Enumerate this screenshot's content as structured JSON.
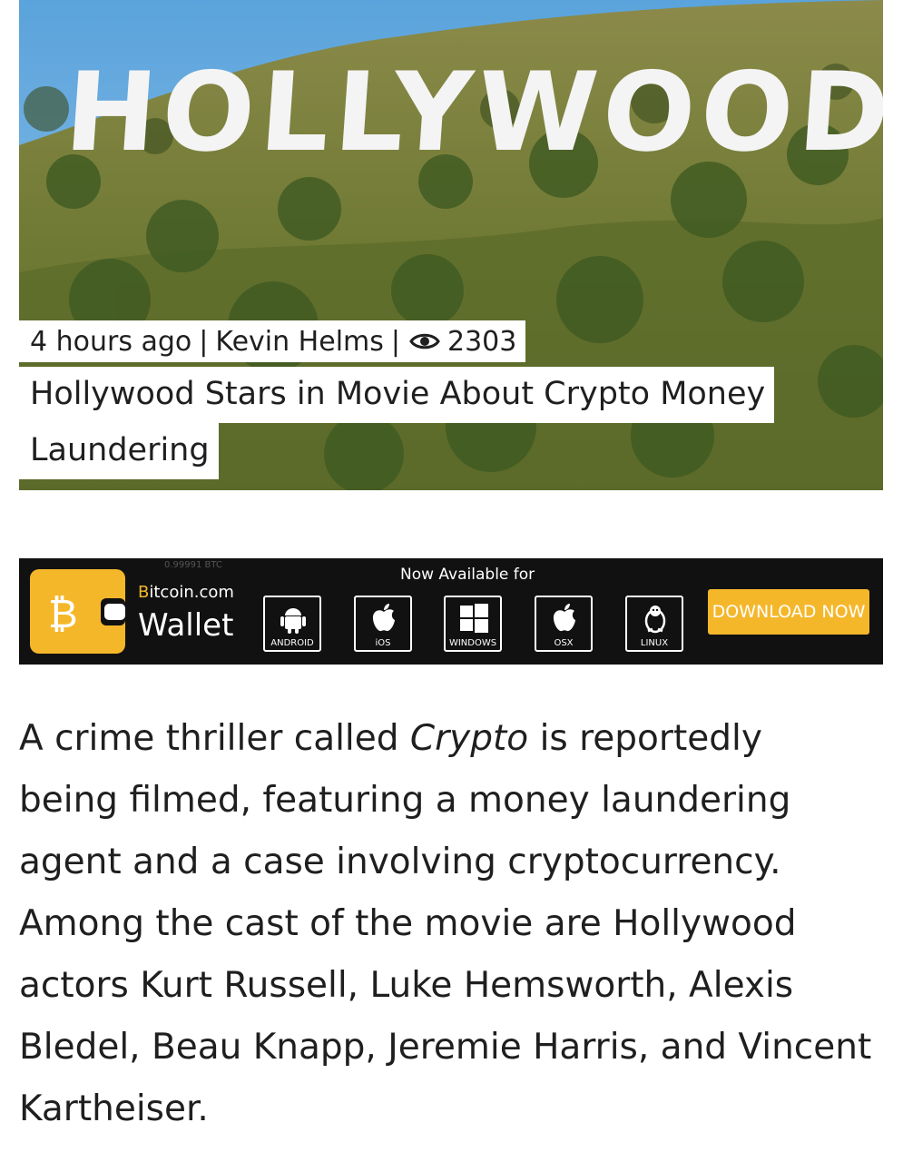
{
  "hero": {
    "sign_text": "HOLLYWOOD",
    "time_ago": "4 hours ago",
    "separator": "|",
    "author": "Kevin Helms",
    "view_count": "2303",
    "title_line1": "Hollywood Stars in Movie About Crypto Money",
    "title_line2": "Laundering"
  },
  "ad": {
    "faint_text": "0.99991 BTC",
    "brand_b": "B",
    "brand_rest": "itcoin.com",
    "product": "Wallet",
    "available": "Now Available for",
    "platforms": [
      "ANDROID",
      "iOS",
      "WINDOWS",
      "OSX",
      "LINUX"
    ],
    "cta": "DOWNLOAD NOW",
    "accent_color": "#f5b72a"
  },
  "article": {
    "p1_before": "A crime thriller called ",
    "p1_italic": "Crypto",
    "p1_after": " is reportedly being filmed, featuring a money laundering agent and a case involving cryptocurrency. Among the cast of the movie are Hollywood actors Kurt Russell, Luke Hemsworth, Alexis Bledel, Beau Knapp, Jeremie Harris, and Vincent Kartheiser."
  }
}
